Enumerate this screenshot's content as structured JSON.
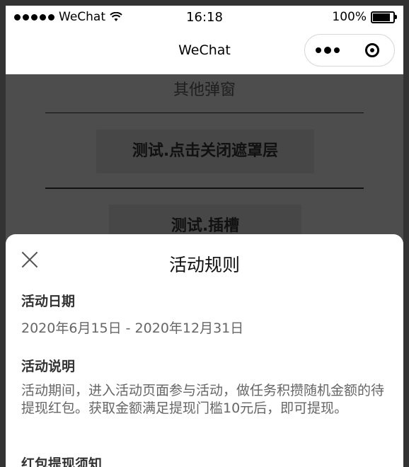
{
  "status_bar": {
    "carrier": "WeChat",
    "time": "16:18",
    "battery": "100%"
  },
  "nav_bar": {
    "title": "WeChat"
  },
  "background": {
    "section_title": "其他弹窗",
    "buttons": [
      "测试.点击关闭遮罩层",
      "测试.插槽"
    ]
  },
  "sheet": {
    "title": "活动规则",
    "sections": [
      {
        "heading": "活动日期",
        "body": "2020年6月15日 - 2020年12月31日"
      },
      {
        "heading": "活动说明",
        "body": "活动期间，进入活动页面参与活动，做任务积攒随机金额的待提现红包。获取金额满足提现门槛10元后，即可提现。"
      },
      {
        "heading": "红包提现须知",
        "body": ""
      }
    ]
  }
}
